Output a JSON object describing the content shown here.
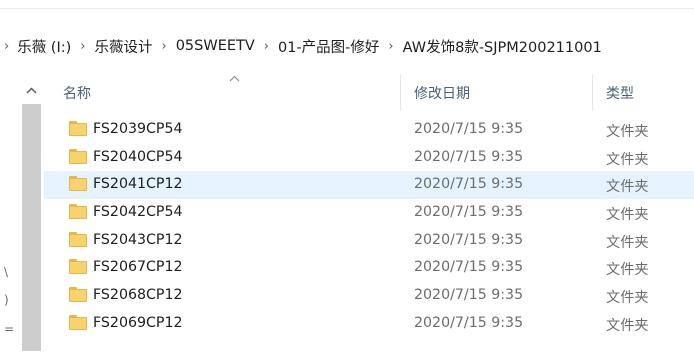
{
  "breadcrumb": {
    "lead": "›",
    "items": [
      "乐薇 (I:)",
      "乐薇设计",
      "05SWEETV",
      "01-产品图-修好",
      "AW发饰8款-SJPM200211001"
    ],
    "separator": "›"
  },
  "columns": {
    "name": "名称",
    "date": "修改日期",
    "type": "类型"
  },
  "rows": [
    {
      "name": "FS2039CP54",
      "date": "2020/7/15 9:35",
      "type": "文件夹",
      "selected": false
    },
    {
      "name": "FS2040CP54",
      "date": "2020/7/15 9:35",
      "type": "文件夹",
      "selected": false
    },
    {
      "name": "FS2041CP12",
      "date": "2020/7/15 9:35",
      "type": "文件夹",
      "selected": true
    },
    {
      "name": "FS2042CP54",
      "date": "2020/7/15 9:35",
      "type": "文件夹",
      "selected": false
    },
    {
      "name": "FS2043CP12",
      "date": "2020/7/15 9:35",
      "type": "文件夹",
      "selected": false
    },
    {
      "name": "FS2067CP12",
      "date": "2020/7/15 9:35",
      "type": "文件夹",
      "selected": false
    },
    {
      "name": "FS2068CP12",
      "date": "2020/7/15 9:35",
      "type": "文件夹",
      "selected": false
    },
    {
      "name": "FS2069CP12",
      "date": "2020/7/15 9:35",
      "type": "文件夹",
      "selected": false
    }
  ],
  "left_pane_glyphs": [
    "\\",
    ")",
    "="
  ],
  "icons": {
    "folder": "folder-icon",
    "sort": "sort-ascending-icon",
    "scroll_up": "scroll-up-arrow-icon"
  },
  "colors": {
    "selected_row": "#e5f3ff",
    "header_text": "#4c607a",
    "folder_yellow": "#f7d26d"
  }
}
